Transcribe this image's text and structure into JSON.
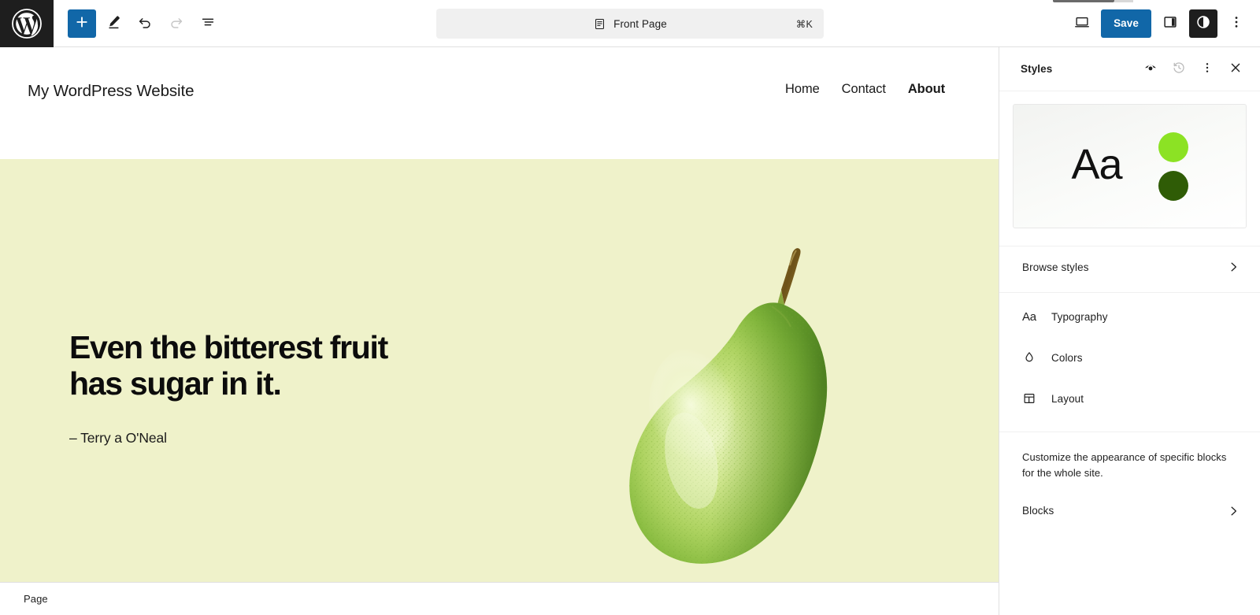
{
  "app": {
    "logo_icon": "wordpress-logo-icon"
  },
  "toolbar": {
    "add_block_label": "+",
    "add_block_icon": "plus-icon",
    "edit_icon": "pencil-icon",
    "undo_icon": "undo-icon",
    "redo_icon": "redo-icon",
    "list_view_icon": "list-view-icon",
    "save_label": "Save",
    "device_preview_icon": "desktop-icon",
    "sidebar_toggle_icon": "sidebar-panel-icon",
    "styles_toggle_icon": "contrast-circle-icon",
    "options_icon": "three-dots-vertical-icon"
  },
  "command_center": {
    "doc_icon": "document-icon",
    "label": "Front Page",
    "shortcut": "⌘K"
  },
  "styles_panel": {
    "title": "Styles",
    "header_actions": [
      {
        "name": "style-book-icon",
        "icon": "eye-icon"
      },
      {
        "name": "revisions-icon",
        "icon": "clock-history-icon"
      },
      {
        "name": "more-options-icon",
        "icon": "three-dots-vertical-icon"
      },
      {
        "name": "close-icon",
        "icon": "close-x-icon"
      }
    ],
    "preview": {
      "sample_text": "Aa",
      "swatch_primary": "#8ce224",
      "swatch_secondary": "#2f5c06"
    },
    "browse_styles": {
      "label": "Browse styles",
      "chevron_icon": "chevron-right-icon"
    },
    "sections": [
      {
        "label": "Typography",
        "icon": "typography-aa-icon",
        "glyph": "Aa"
      },
      {
        "label": "Colors",
        "icon": "color-drop-icon",
        "glyph": ""
      },
      {
        "label": "Layout",
        "icon": "layout-grid-icon",
        "glyph": ""
      }
    ],
    "blocks_description": "Customize the appearance of specific blocks for the whole site.",
    "blocks_row": {
      "label": "Blocks",
      "chevron_icon": "chevron-right-icon"
    }
  },
  "site": {
    "title": "My WordPress Website",
    "nav": [
      {
        "label": "Home",
        "current": false
      },
      {
        "label": "Contact",
        "current": false
      },
      {
        "label": "About",
        "current": true
      }
    ],
    "hero": {
      "background_color": "#eff2ca",
      "quote_line_1": "Even the bitterest fruit",
      "quote_line_2": "has sugar in it.",
      "attribution": "– Terry a O'Neal",
      "image_alt": "pear-illustration"
    }
  },
  "status_bar": {
    "label": "Page"
  },
  "colors": {
    "accent": "#1167a8",
    "dark": "#1e1e1e",
    "hero_bg": "#eff2ca"
  }
}
